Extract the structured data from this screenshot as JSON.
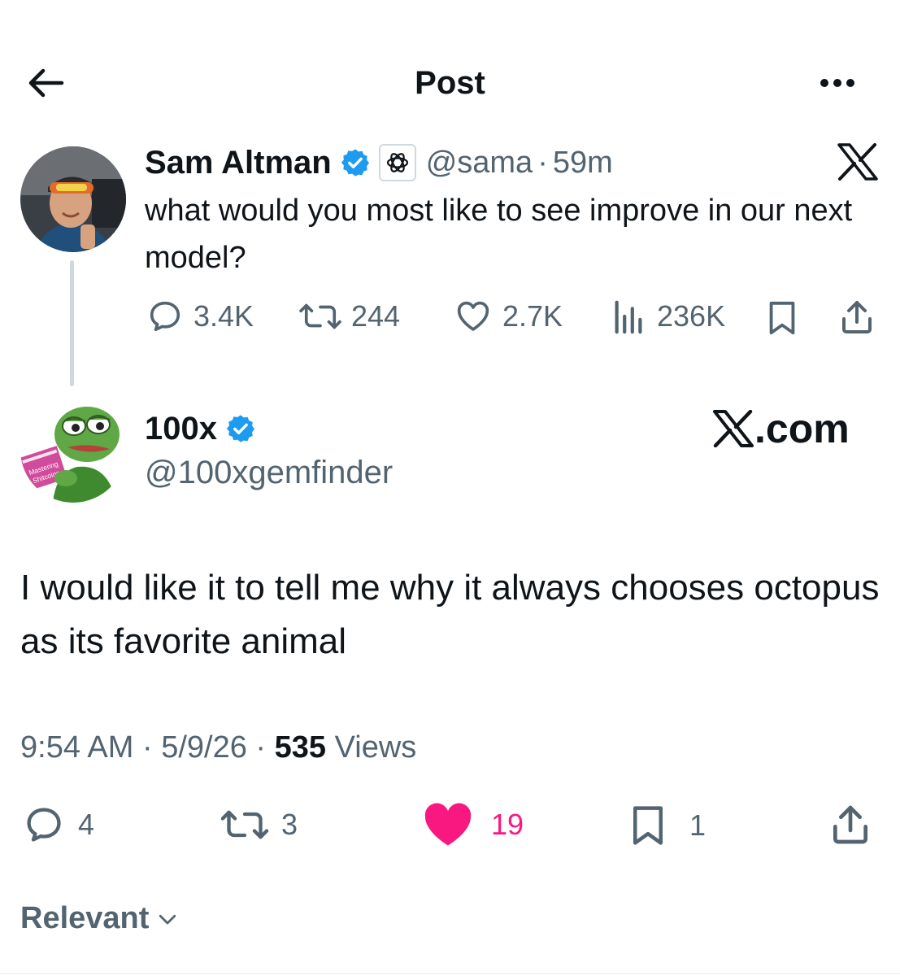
{
  "header": {
    "title": "Post"
  },
  "parent_post": {
    "author_name": "Sam Altman",
    "handle": "@sama",
    "separator": "·",
    "time_ago": "59m",
    "text": "what would you most like to see improve in our next model?",
    "replies": "3.4K",
    "reposts": "244",
    "likes": "2.7K",
    "views": "236K"
  },
  "reply_post": {
    "author_name": "100x",
    "handle": "@100xgemfinder",
    "brand_text": ".com",
    "text": "I would like it to tell me why it always chooses octopus as its favorite animal",
    "time": "9:54 AM",
    "date": "5/9/26",
    "separator": "·",
    "views_count": "535",
    "views_label": "Views",
    "replies": "4",
    "reposts": "3",
    "likes": "19",
    "bookmarks": "1",
    "book_cover_text": "Mastering Shitcoins"
  },
  "sort": {
    "label": "Relevant"
  },
  "colors": {
    "verified": "#1d9bf0",
    "liked": "#f91880",
    "secondary_text": "#536471",
    "thread_line": "#cfd9de"
  }
}
